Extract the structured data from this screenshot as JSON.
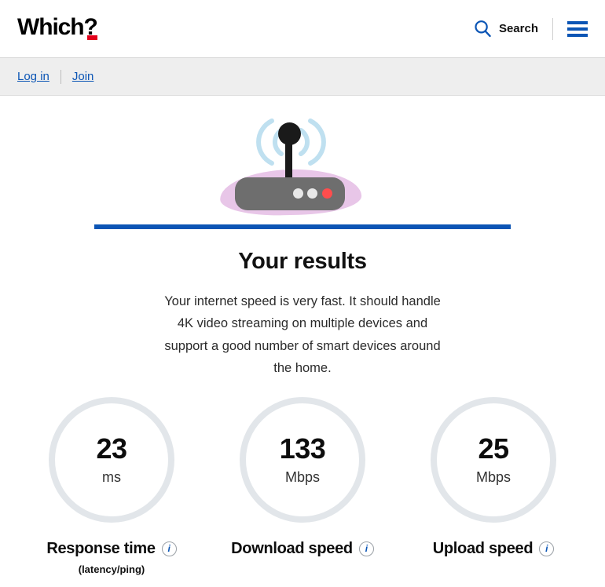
{
  "header": {
    "logo_text": "Which",
    "logo_qmark": "?",
    "search_label": "Search",
    "search_icon": "search-icon",
    "menu_icon": "hamburger-menu-icon"
  },
  "account_bar": {
    "login_label": "Log in",
    "join_label": "Join"
  },
  "hero": {
    "illustration": "wifi-router-icon",
    "colors": {
      "blob": "#e8c6e8",
      "router_body": "#6e6e6e",
      "antenna": "#1a1a1a",
      "wave": "#bfe0f0",
      "led_off": "#e8e8e8",
      "led_on": "#ff4d4d"
    }
  },
  "results": {
    "accent_color": "#0b55b5",
    "title": "Your results",
    "description": "Your internet speed is very fast. It should handle 4K video streaming on multiple devices and support a good number of smart devices around the home."
  },
  "gauges": [
    {
      "value": "23",
      "unit": "ms",
      "label": "Response time",
      "sublabel": "(latency/ping)",
      "info_icon": "info-icon"
    },
    {
      "value": "133",
      "unit": "Mbps",
      "label": "Download speed",
      "sublabel": "",
      "info_icon": "info-icon"
    },
    {
      "value": "25",
      "unit": "Mbps",
      "label": "Upload speed",
      "sublabel": "",
      "info_icon": "info-icon"
    }
  ]
}
